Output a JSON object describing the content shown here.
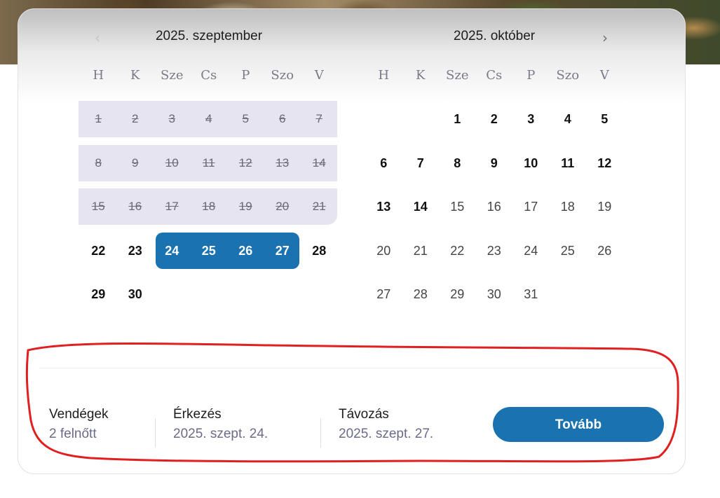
{
  "calendar": {
    "september": {
      "title": "2025. szeptember",
      "weekdays": [
        "H",
        "K",
        "Sze",
        "Cs",
        "P",
        "Szo",
        "V"
      ],
      "weeks": [
        [
          "1",
          "2",
          "3",
          "4",
          "5",
          "6",
          "7"
        ],
        [
          "8",
          "9",
          "10",
          "11",
          "12",
          "13",
          "14"
        ],
        [
          "15",
          "16",
          "17",
          "18",
          "19",
          "20",
          "21"
        ],
        [
          "22",
          "23",
          "24",
          "25",
          "26",
          "27",
          "28"
        ],
        [
          "29",
          "30",
          "",
          "",
          "",
          "",
          ""
        ]
      ],
      "disabled_weeks": [
        0,
        1,
        2
      ],
      "selected_start": "24",
      "selected_end": "27"
    },
    "october": {
      "title": "2025. október",
      "weekdays": [
        "H",
        "K",
        "Sze",
        "Cs",
        "P",
        "Szo",
        "V"
      ],
      "weeks": [
        [
          "",
          "",
          "1",
          "2",
          "3",
          "4",
          "5"
        ],
        [
          "6",
          "7",
          "8",
          "9",
          "10",
          "11",
          "12"
        ],
        [
          "13",
          "14",
          "15",
          "16",
          "17",
          "18",
          "19"
        ],
        [
          "20",
          "21",
          "22",
          "23",
          "24",
          "25",
          "26"
        ],
        [
          "27",
          "28",
          "29",
          "30",
          "31",
          "",
          ""
        ]
      ],
      "bold_until": "14"
    },
    "prev_icon": "chevron-left-icon",
    "next_icon": "chevron-right-icon"
  },
  "footer": {
    "guests_label": "Vendégek",
    "guests_value": "2 felnőtt",
    "arrival_label": "Érkezés",
    "arrival_value": "2025. szept. 24.",
    "departure_label": "Távozás",
    "departure_value": "2025. szept. 27.",
    "next_button": "Tovább"
  },
  "colors": {
    "accent": "#1b72b0",
    "disabled_band": "#e6e4f0",
    "annotation": "#e02020"
  }
}
